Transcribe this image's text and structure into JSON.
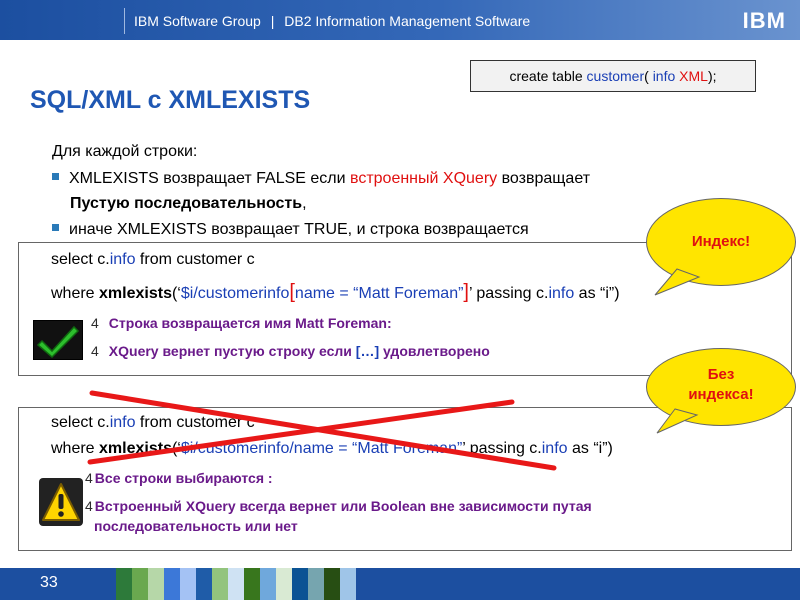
{
  "header": {
    "group": "IBM Software Group",
    "separator": "|",
    "product": "DB2 Information Management Software",
    "logo": "IBM"
  },
  "code_box": {
    "part1": "create table ",
    "part2": "customer",
    "part3": "( ",
    "part4": "info",
    "part5": " ",
    "part6": "XML",
    "part7": ");"
  },
  "title": "SQL/XML с XMLEXISTS",
  "intro": "Для каждой строки:",
  "bullet1": {
    "a": "XMLEXISTS возвращает FALSE если ",
    "b": "встроенный XQuery",
    "c": " возвращает",
    "d": "Пустую последовательность",
    "e": ","
  },
  "bullet2": "иначе XMLEXISTS возвращает TRUE, и строка возвращается",
  "box1": {
    "line1_a": "select c.",
    "line1_b": "info",
    "line1_c": "  from customer c",
    "line2_a": "where ",
    "line2_b": "xmlexists",
    "line2_c": "(‘",
    "line2_d": "$i/customerinfo",
    "line2_e": "[",
    "line2_f": "name = “Matt Foreman”",
    "line2_g": "]",
    "line2_h": "’ passing c.",
    "line2_i": "info",
    "line2_j": " as “i”)",
    "sub_num": "4",
    "sub1": "Строка возвращается имя Matt Foreman:",
    "sub2_a": "XQuery вернет пустую строку  если ",
    "sub2_b": "[…]",
    "sub2_c": " удовлетворено"
  },
  "box2": {
    "line1_a": "select c.",
    "line1_b": "info",
    "line1_c": "  from customer c",
    "line2_a": "where ",
    "line2_b": "xmlexists",
    "line2_c": "(‘",
    "line2_d": "$i/customerinfo/name = “Matt Foreman”",
    "line2_e": "’ passing c.",
    "line2_f": "info",
    "line2_g": " as “i”)",
    "sub_num": "4",
    "sub1": "Все строки выбираются :",
    "sub2": "Встроенный XQuery всегда вернет или Boolean вне зависимости путая",
    "sub3": "последовательность или нет"
  },
  "bubble_index": "Индекс!",
  "bubble_noindex_1": "Без",
  "bubble_noindex_2": "индекса!",
  "page_number": "33",
  "colors": {
    "accent_blue": "#1f57b3",
    "highlight_red": "#e01010",
    "bubble_yellow": "#ffe500",
    "check_green": "#1a9a1a"
  },
  "icons": [
    "checkmark-icon",
    "warning-icon",
    "red-cross-mark"
  ]
}
